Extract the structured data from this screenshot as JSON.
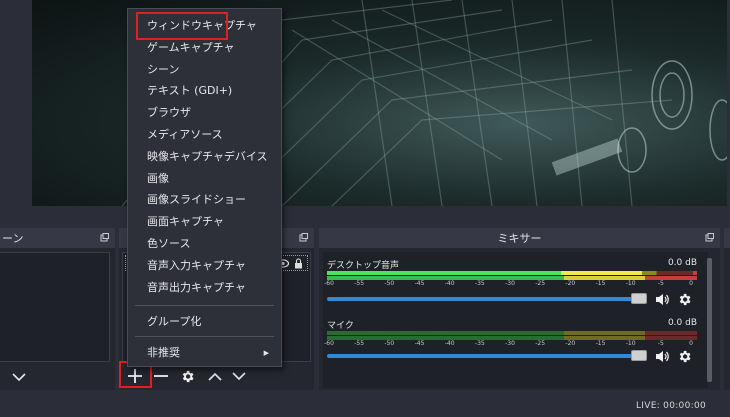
{
  "docks": {
    "scenes_title": "ーン",
    "sources_title": "",
    "mixer_title": "ミキサー"
  },
  "context_menu": {
    "items": [
      "ウィンドウキャプチャ",
      "ゲームキャプチャ",
      "シーン",
      "テキスト (GDI+)",
      "ブラウザ",
      "メディアソース",
      "映像キャプチャデバイス",
      "画像",
      "画像スライドショー",
      "画面キャプチャ",
      "色ソース",
      "音声入力キャプチャ",
      "音声出力キャプチャ"
    ],
    "group_label": "グループ化",
    "deprecated_label": "非推奨",
    "submenu_arrow": "▶",
    "highlighted_item": "ウィンドウキャプチャ"
  },
  "mixer": {
    "channels": [
      {
        "name": "デスクトップ音声",
        "level": "0.0 dB"
      },
      {
        "name": "マイク",
        "level": "0.0 dB"
      }
    ],
    "scale": [
      "-60",
      "-55",
      "-50",
      "-45",
      "-40",
      "-35",
      "-30",
      "-25",
      "-20",
      "-15",
      "-10",
      "-5",
      "0"
    ],
    "volume_fraction": 1.0
  },
  "status": {
    "live": "LIVE: 00:00:00"
  },
  "icons": {
    "add": "plus-icon",
    "remove": "minus-icon",
    "settings": "gear-icon",
    "up": "chevron-up-icon",
    "down": "chevron-down-icon",
    "speaker": "speaker-icon",
    "float": "float-dock-icon"
  },
  "colors": {
    "highlight_box": "#e02020",
    "fader": "#2f8ad8",
    "meter_green": "#3dbb4e",
    "meter_yellow": "#d8cf3c",
    "meter_red": "#c24040"
  }
}
